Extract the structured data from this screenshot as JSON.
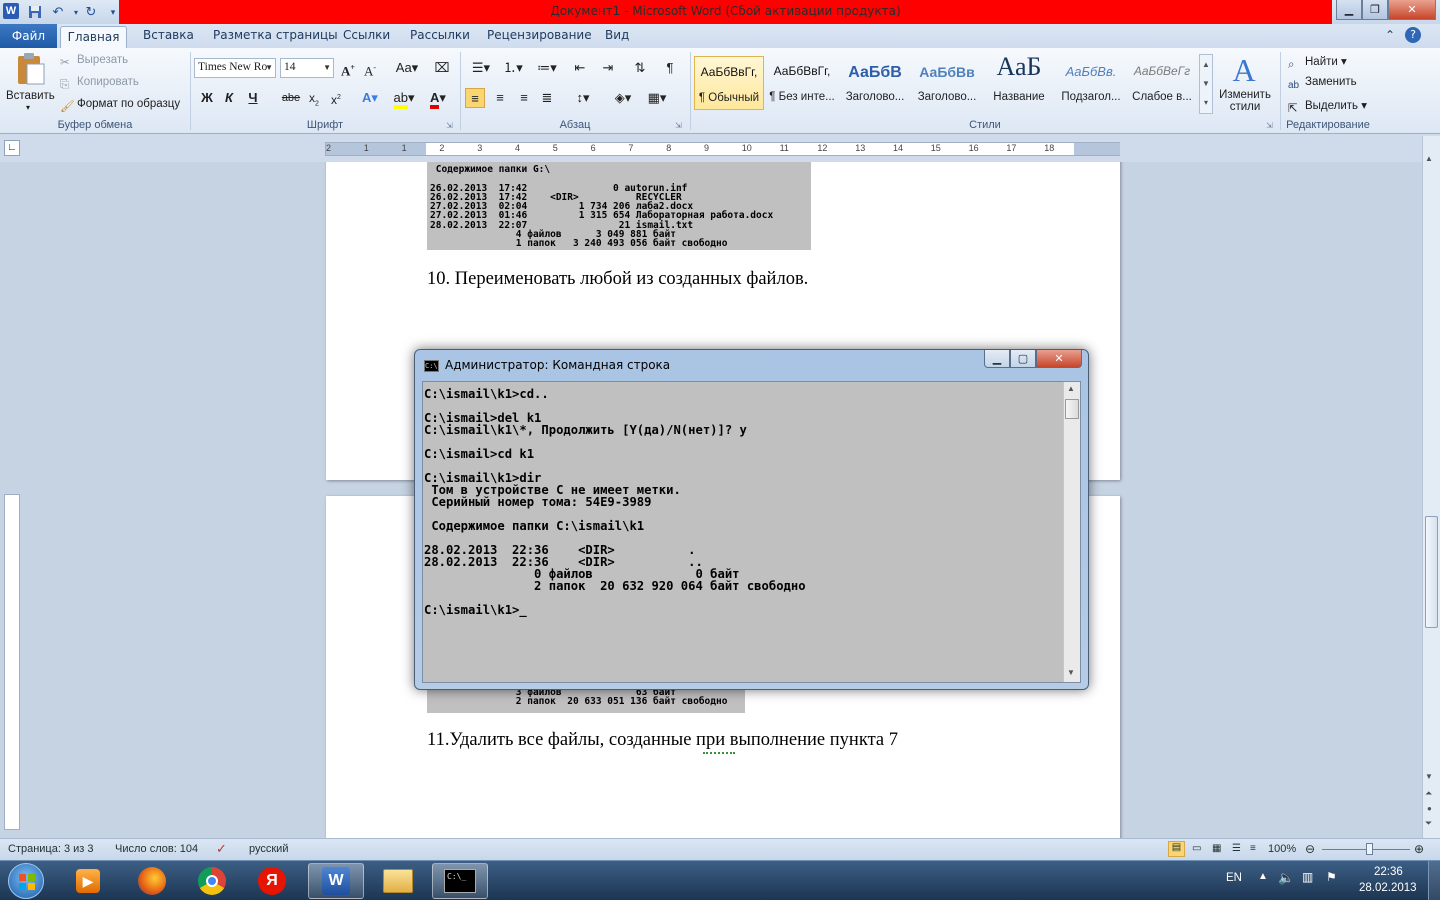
{
  "window": {
    "title": "Документ1 - Microsoft Word (Сбой активации продукта)"
  },
  "tabs": {
    "file": "Файл",
    "home": "Главная",
    "insert": "Вставка",
    "layout": "Разметка страницы",
    "references": "Ссылки",
    "mailings": "Рассылки",
    "review": "Рецензирование",
    "view": "Вид"
  },
  "clipboard": {
    "paste": "Вставить",
    "cut": "Вырезать",
    "copy": "Копировать",
    "format_painter": "Формат по образцу",
    "label": "Буфер обмена"
  },
  "font": {
    "name": "Times New Ro",
    "size": "14",
    "label": "Шрифт",
    "bold": "Ж",
    "italic": "К",
    "underline": "Ч",
    "strike": "abe"
  },
  "paragraph": {
    "label": "Абзац"
  },
  "styles": {
    "label": "Стили",
    "change_styles": "Изменить стили",
    "items": [
      {
        "sample": "АаБбВвГг,",
        "name": "¶ Обычный"
      },
      {
        "sample": "АаБбВвГг,",
        "name": "¶ Без инте..."
      },
      {
        "sample": "АаБбВ",
        "name": "Заголово..."
      },
      {
        "sample": "АаБбВв",
        "name": "Заголово..."
      },
      {
        "sample": "АаБ",
        "name": "Название"
      },
      {
        "sample": "АаБбВв.",
        "name": "Подзагол..."
      },
      {
        "sample": "АаБбВеГг",
        "name": "Слабое в..."
      }
    ]
  },
  "editing": {
    "label": "Редактирование",
    "find": "Найти",
    "replace": "Заменить",
    "select": "Выделить"
  },
  "ruler": {
    "marks": [
      "2",
      "1",
      "1",
      "2",
      "3",
      "4",
      "5",
      "6",
      "7",
      "8",
      "9",
      "10",
      "11",
      "12",
      "13",
      "14",
      "15",
      "16",
      "17",
      "18"
    ]
  },
  "document": {
    "shot1_text": " Содержимое папки G:\\\n\n26.02.2013  17:42               0 autorun.inf\n26.02.2013  17:42    <DIR>          RECYCLER\n27.02.2013  02:04         1 734 206 лаба2.docx\n27.02.2013  01:46         1 315 654 Лабораторная работа.docx\n28.02.2013  22:07                21 ismail.txt\n               4 файлов      3 049 881 байт\n               1 папок   3 240 493 056 байт свободно",
    "item10": "10. Переименовать любой из созданных файлов.",
    "shot2_text": "               3 файлов             63 байт\n               2 папок  20 633 051 136 байт свободно",
    "item11": "11.Удалить все файлы, созданные при выполнение пункта 7"
  },
  "cmd": {
    "title": "Администратор: Командная строка",
    "output": "C:\\ismail\\k1>cd..\n\nC:\\ismail>del k1\nC:\\ismail\\k1\\*, Продолжить [Y(да)/N(нет)]? y\n\nC:\\ismail>cd k1\n\nC:\\ismail\\k1>dir\n Том в устройстве C не имеет метки.\n Серийный номер тома: 54E9-3989\n\n Содержимое папки C:\\ismail\\k1\n\n28.02.2013  22:36    <DIR>          .\n28.02.2013  22:36    <DIR>          ..\n               0 файлов              0 байт\n               2 папок  20 632 920 064 байт свободно\n\nC:\\ismail\\k1>_"
  },
  "status": {
    "page": "Страница: 3 из 3",
    "words": "Число слов: 104",
    "language": "русский",
    "zoom": "100%"
  },
  "tray": {
    "lang": "EN",
    "time": "22:36",
    "date": "28.02.2013"
  },
  "colors": {
    "title_red": "#ff0000",
    "file_tab": "#2b579a",
    "console_bg": "#c0c0c0"
  }
}
